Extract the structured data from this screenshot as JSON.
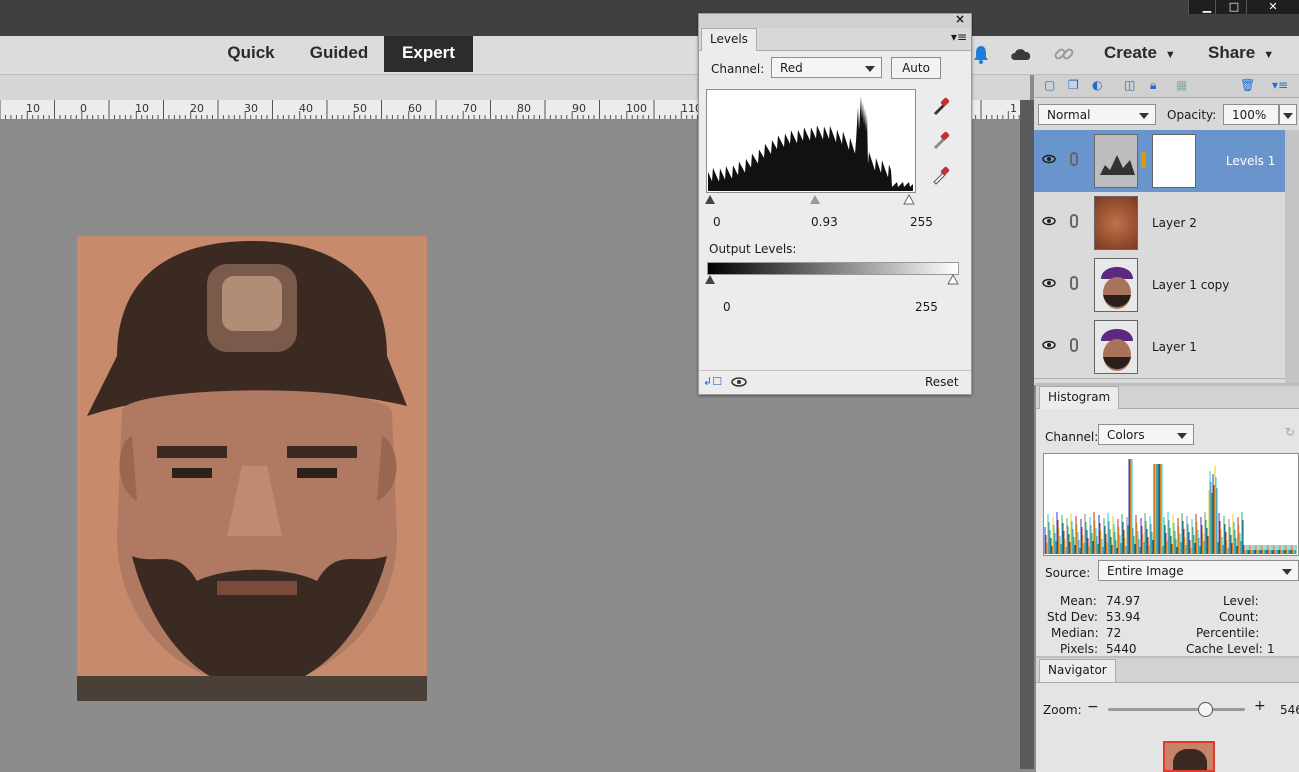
{
  "window": {
    "minimize": "▁",
    "maximize": "□",
    "close": "✕"
  },
  "modes": [
    "Quick",
    "Guided",
    "Expert"
  ],
  "toolbar": {
    "create": "Create",
    "share": "Share"
  },
  "ruler": {
    "labels": [
      "10",
      "0",
      "10",
      "20",
      "30",
      "40",
      "50",
      "60",
      "70",
      "80",
      "90",
      "100",
      "110",
      "1"
    ]
  },
  "levels": {
    "tab": "Levels",
    "channel_label": "Channel:",
    "channel_value": "Red",
    "auto": "Auto",
    "input_black": "0",
    "input_mid": "0.93",
    "input_white": "255",
    "output_label": "Output Levels:",
    "output_black": "0",
    "output_white": "255",
    "reset": "Reset"
  },
  "layers": {
    "blend_mode": "Normal",
    "opacity_label": "Opacity:",
    "opacity_value": "100%",
    "items": [
      {
        "name": "Levels 1",
        "selected": true
      },
      {
        "name": "Layer 2",
        "selected": false
      },
      {
        "name": "Layer 1 copy",
        "selected": false
      },
      {
        "name": "Layer 1",
        "selected": false
      }
    ]
  },
  "histogram": {
    "tab": "Histogram",
    "channel_label": "Channel:",
    "channel_value": "Colors",
    "source_label": "Source:",
    "source_value": "Entire Image",
    "stats": {
      "mean_label": "Mean:",
      "mean": "74.97",
      "stddev_label": "Std Dev:",
      "stddev": "53.94",
      "median_label": "Median:",
      "median": "72",
      "pixels_label": "Pixels:",
      "pixels": "5440",
      "level_label": "Level:",
      "count_label": "Count:",
      "percentile_label": "Percentile:",
      "cache_label": "Cache Level:",
      "cache": "1"
    }
  },
  "navigator": {
    "tab": "Navigator",
    "zoom_label": "Zoom:",
    "zoom_value": "546"
  },
  "colors": {
    "accent": "#6a94cc",
    "dark": "#2c2c2c"
  }
}
